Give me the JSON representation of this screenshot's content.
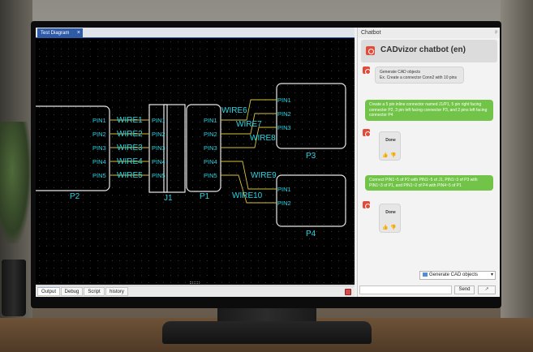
{
  "document_tab": {
    "title": "Test Diagram",
    "close": "×"
  },
  "diagram": {
    "wire_color": "#d9c23a",
    "text_color": "#27d7e6",
    "connectors": [
      {
        "name": "P2",
        "pins": [
          "PIN1",
          "PIN2",
          "PIN3",
          "PIN4",
          "PIN5"
        ]
      },
      {
        "name": "J1",
        "pins_left": [
          "PIN1",
          "PIN2",
          "PIN3",
          "PIN4",
          "PIN5"
        ],
        "pins_right": [
          "PIN1",
          "PIN2",
          "PIN3",
          "PIN4",
          "PIN5"
        ]
      },
      {
        "name": "P1",
        "pins": [
          "PIN1",
          "PIN2",
          "PIN3",
          "PIN4",
          "PIN5"
        ]
      },
      {
        "name": "P3",
        "pins": [
          "PIN1",
          "PIN2",
          "PIN3"
        ]
      },
      {
        "name": "P4",
        "pins": [
          "PIN1",
          "PIN2"
        ]
      }
    ],
    "wires": [
      "WIRE1",
      "WIRE2",
      "WIRE3",
      "WIRE4",
      "WIRE5",
      "WIRE6",
      "WIRE7",
      "WIRE8",
      "WIRE9",
      "WIRE10"
    ]
  },
  "bottom_tabs": [
    "Output",
    "Debug",
    "Script",
    "history"
  ],
  "chatbot": {
    "pane_title": "Chatbot",
    "pin": "ᵖ",
    "title": "CADvizor chatbot (en)",
    "messages": [
      {
        "role": "bot",
        "text": "Generate CAD objects\nEx. Create a connector Conn2 with 10 pins"
      },
      {
        "role": "user",
        "text": "Create a 5 pin inline connector named J1/P1, 5 pin right facing connector P2, 3 pin left facing connector P3, and 2 pins left facing connector P4"
      },
      {
        "role": "bot",
        "text": "Done"
      },
      {
        "role": "user",
        "text": "Connect PIN1~5 of P2 with PIN1~5 of J1, PIN1~3 of P3 with PIN1~3 of P1, and PIN1~2 of P4 with PIN4~5 of P1"
      },
      {
        "role": "bot",
        "text": "Done"
      }
    ],
    "thumbs_up": "👍",
    "thumbs_down": "👎",
    "mode_select": "Generate CAD objects",
    "send_label": "Send",
    "tool_label": "↗"
  }
}
